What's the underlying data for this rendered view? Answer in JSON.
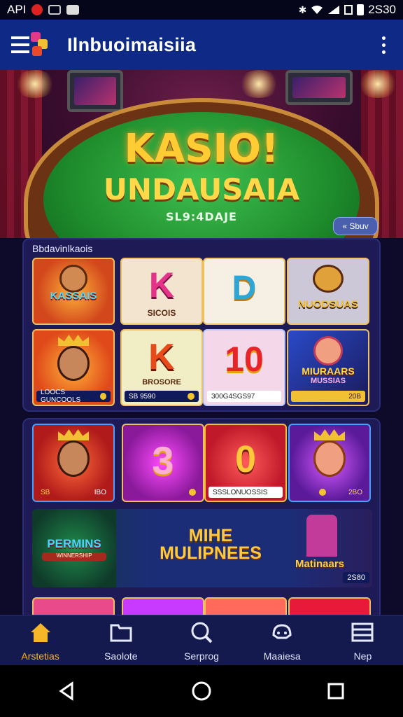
{
  "status_bar": {
    "left_text": "API",
    "time": "2S30"
  },
  "app_bar": {
    "title": "Ilnbuoimaisiia"
  },
  "hero": {
    "title_line1": "KASIO!",
    "title_line2": "UNDAUSAIA",
    "subtitle": "SL9:4DAJE",
    "tag": "« Sbuv"
  },
  "section1": {
    "title": "Bbdavinlkaois",
    "games": [
      {
        "label": "KASSAIS",
        "sub": ""
      },
      {
        "label": "K",
        "sub": "SICOIS"
      },
      {
        "label": "D",
        "sub": ""
      },
      {
        "label": "NUODSUAS",
        "sub": ""
      },
      {
        "label": "",
        "bar": "LOOCS GUNCOOLS"
      },
      {
        "label": "K",
        "sub": "BROSORE",
        "bar": "SB 9590"
      },
      {
        "label": "10",
        "bar": "300G4SGS97"
      },
      {
        "label": "MIURAARS",
        "sub": "MUSSIAS",
        "bar": "20B"
      }
    ]
  },
  "section2": {
    "games": [
      {
        "bar_left": "SB",
        "bar_right": "IBO"
      },
      {
        "label": "3"
      },
      {
        "label": "0",
        "bar": "SSSLONUOSSIS"
      },
      {
        "bar_right": "2BO"
      }
    ],
    "wide_tile": {
      "left_label": "PERMINS",
      "left_sub": "WINNERSHIP",
      "center_line1": "MIHE",
      "center_line2": "MULIPNEES",
      "right_label": "Matinaars",
      "badge": "2S80"
    }
  },
  "bottom_nav": [
    {
      "label": "Arstetias",
      "icon": "home-icon",
      "active": true
    },
    {
      "label": "Saolote",
      "icon": "folder-icon",
      "active": false
    },
    {
      "label": "Serprog",
      "icon": "search-icon",
      "active": false
    },
    {
      "label": "Maaiesa",
      "icon": "controller-icon",
      "active": false
    },
    {
      "label": "Nep",
      "icon": "menu-icon",
      "active": false
    }
  ],
  "colors": {
    "app_bar": "#0f2a86",
    "accent": "#f6b62a",
    "panel": "#1e1c5a"
  }
}
